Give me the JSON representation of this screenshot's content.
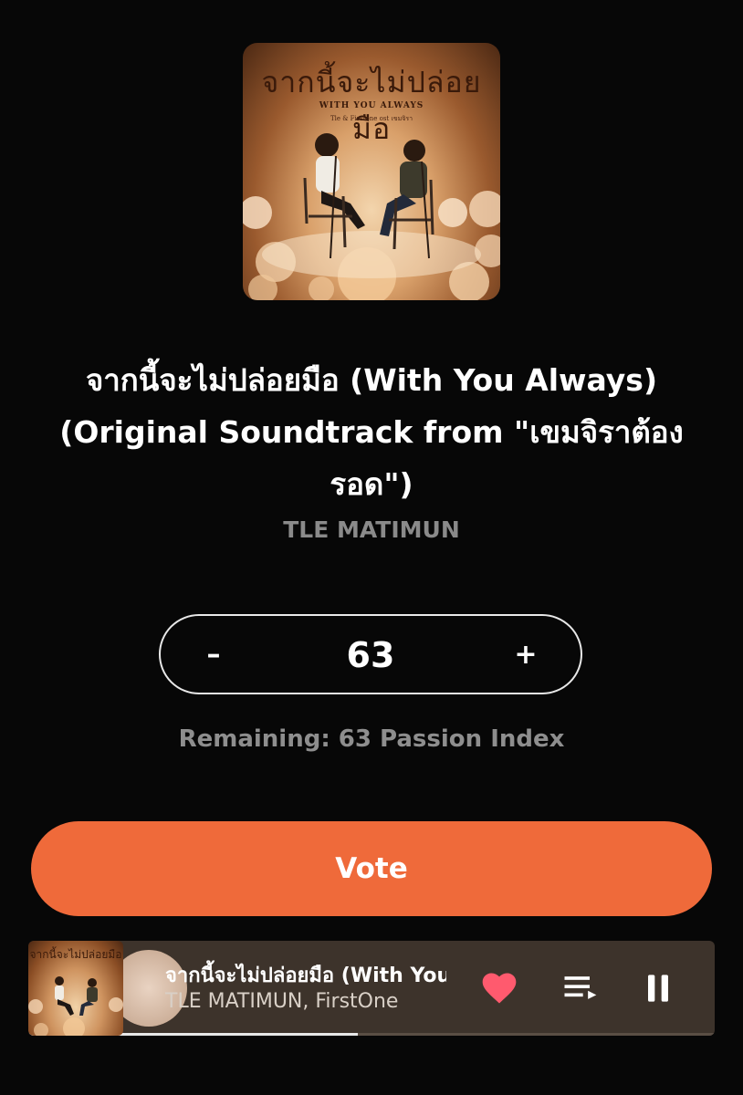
{
  "album": {
    "art_title": "จากนี้จะไม่ปล่อยมือ",
    "art_subtitle": "WITH YOU ALWAYS",
    "art_credit": "Tle & Firstone ost เขมจิรา"
  },
  "song": {
    "title": "จากนี้จะไม่ปล่อยมือ (With You Always) (Original Soundtrack from \"เขมจิราต้องรอด\")",
    "artist": "TLE MATIMUN"
  },
  "stepper": {
    "minus_label": "–",
    "value": "63",
    "plus_label": "+"
  },
  "remaining_text": "Remaining: 63 Passion Index",
  "vote_label": "Vote",
  "mini_player": {
    "title": "จากนี้จะไม่ปล่อยมือ (With You Always)",
    "artist": "TLE MATIMUN, FirstOne",
    "progress": 0.48,
    "icons": [
      "heart-icon",
      "queue-icon",
      "pause-icon"
    ],
    "heart_color": "#ff5a6e"
  },
  "colors": {
    "accent": "#ef6a3a",
    "background": "#070707",
    "mini_player_bg": "#3d332b"
  }
}
